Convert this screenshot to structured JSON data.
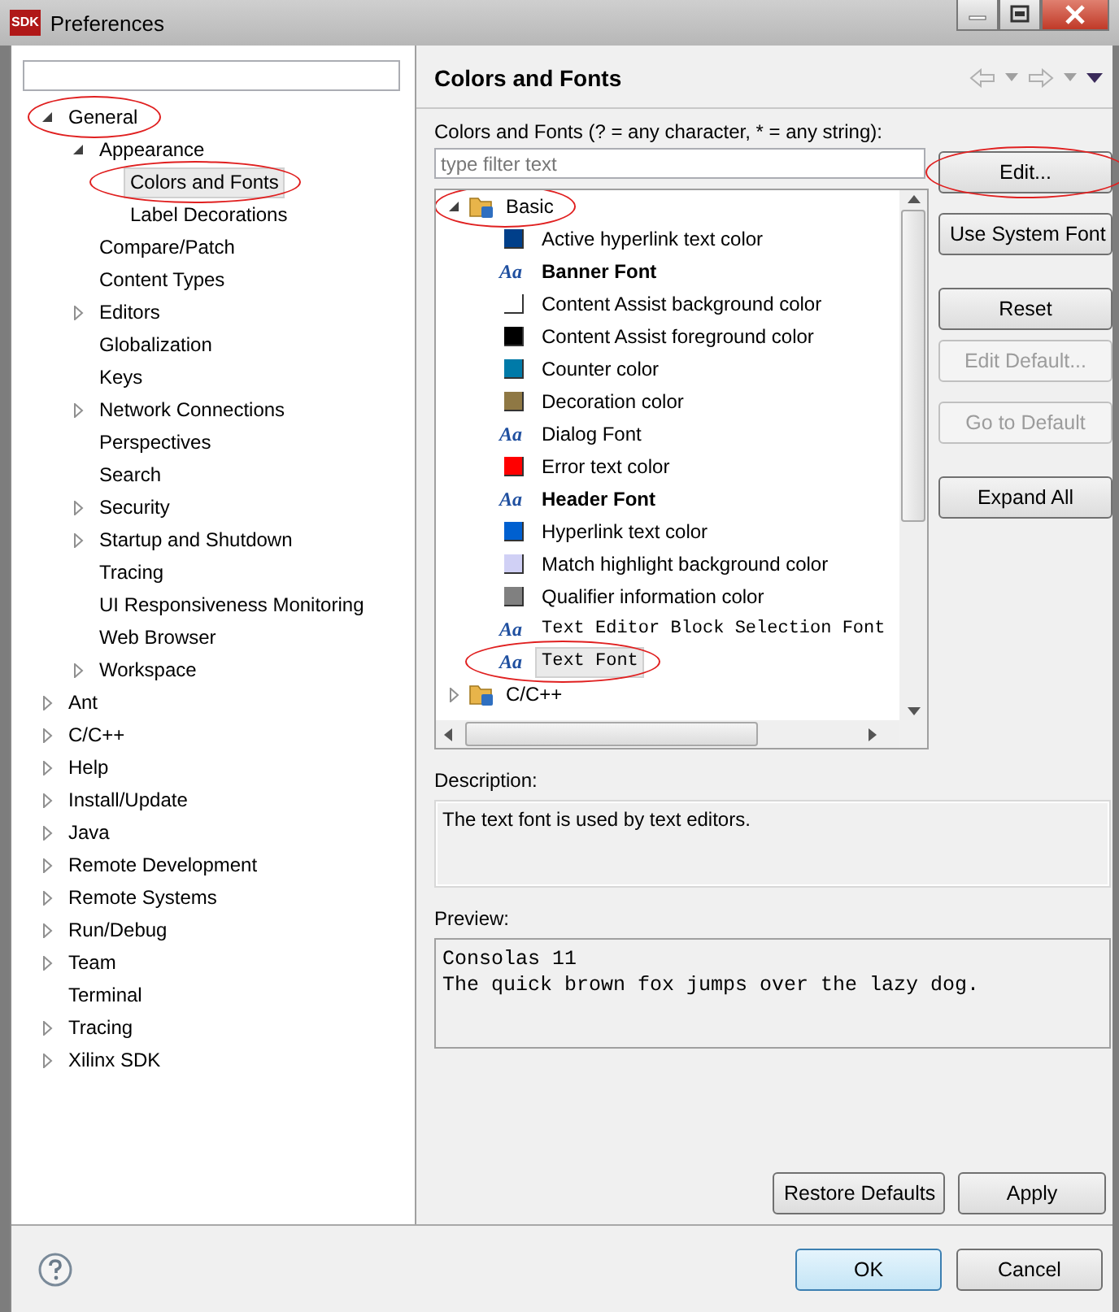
{
  "window": {
    "title": "Preferences",
    "app_icon": "SDK"
  },
  "sidebar": {
    "tree": [
      {
        "label": "General",
        "kind": "branch",
        "expanded": true,
        "selected": false,
        "circled": true,
        "children": [
          {
            "label": "Appearance",
            "kind": "branch",
            "expanded": true,
            "selected": false,
            "circled": false,
            "children": [
              {
                "label": "Colors and Fonts",
                "kind": "leaf",
                "selected": true,
                "circled": true
              },
              {
                "label": "Label Decorations",
                "kind": "leaf",
                "selected": false,
                "circled": false
              }
            ]
          },
          {
            "label": "Compare/Patch",
            "kind": "leaf",
            "selected": false,
            "circled": false
          },
          {
            "label": "Content Types",
            "kind": "leaf",
            "selected": false,
            "circled": false
          },
          {
            "label": "Editors",
            "kind": "branch",
            "expanded": false,
            "selected": false,
            "circled": false
          },
          {
            "label": "Globalization",
            "kind": "leaf",
            "selected": false,
            "circled": false
          },
          {
            "label": "Keys",
            "kind": "leaf",
            "selected": false,
            "circled": false
          },
          {
            "label": "Network Connections",
            "kind": "branch",
            "expanded": false,
            "selected": false,
            "circled": false
          },
          {
            "label": "Perspectives",
            "kind": "leaf",
            "selected": false,
            "circled": false
          },
          {
            "label": "Search",
            "kind": "leaf",
            "selected": false,
            "circled": false
          },
          {
            "label": "Security",
            "kind": "branch",
            "expanded": false,
            "selected": false,
            "circled": false
          },
          {
            "label": "Startup and Shutdown",
            "kind": "branch",
            "expanded": false,
            "selected": false,
            "circled": false
          },
          {
            "label": "Tracing",
            "kind": "leaf",
            "selected": false,
            "circled": false
          },
          {
            "label": "UI Responsiveness Monitoring",
            "kind": "leaf",
            "selected": false,
            "circled": false
          },
          {
            "label": "Web Browser",
            "kind": "leaf",
            "selected": false,
            "circled": false
          },
          {
            "label": "Workspace",
            "kind": "branch",
            "expanded": false,
            "selected": false,
            "circled": false
          }
        ]
      },
      {
        "label": "Ant",
        "kind": "branch",
        "expanded": false,
        "selected": false,
        "circled": false
      },
      {
        "label": "C/C++",
        "kind": "branch",
        "expanded": false,
        "selected": false,
        "circled": false
      },
      {
        "label": "Help",
        "kind": "branch",
        "expanded": false,
        "selected": false,
        "circled": false
      },
      {
        "label": "Install/Update",
        "kind": "branch",
        "expanded": false,
        "selected": false,
        "circled": false
      },
      {
        "label": "Java",
        "kind": "branch",
        "expanded": false,
        "selected": false,
        "circled": false
      },
      {
        "label": "Remote Development",
        "kind": "branch",
        "expanded": false,
        "selected": false,
        "circled": false
      },
      {
        "label": "Remote Systems",
        "kind": "branch",
        "expanded": false,
        "selected": false,
        "circled": false
      },
      {
        "label": "Run/Debug",
        "kind": "branch",
        "expanded": false,
        "selected": false,
        "circled": false
      },
      {
        "label": "Team",
        "kind": "branch",
        "expanded": false,
        "selected": false,
        "circled": false
      },
      {
        "label": "Terminal",
        "kind": "leaf",
        "selected": false,
        "circled": false
      },
      {
        "label": "Tracing",
        "kind": "branch",
        "expanded": false,
        "selected": false,
        "circled": false
      },
      {
        "label": "Xilinx SDK",
        "kind": "branch",
        "expanded": false,
        "selected": false,
        "circled": false
      }
    ]
  },
  "page": {
    "title": "Colors and Fonts",
    "filter_label": "Colors and Fonts (? = any character, * = any string):",
    "filter": {
      "placeholder": "type filter text"
    },
    "tree": [
      {
        "label": "Basic",
        "kind": "category",
        "expanded": true,
        "selected": false,
        "circled": true,
        "children": [
          {
            "label": "Active hyperlink text color",
            "kind": "color",
            "color": "#003f8a",
            "selected": false,
            "circled": false
          },
          {
            "label": "Banner Font",
            "kind": "font",
            "icon": "Aa",
            "bold": true,
            "monospace": false,
            "selected": false,
            "circled": false
          },
          {
            "label": "Content Assist background color",
            "kind": "color",
            "color": "#ffffff",
            "selected": false,
            "circled": false
          },
          {
            "label": "Content Assist foreground color",
            "kind": "color",
            "color": "#000000",
            "selected": false,
            "circled": false
          },
          {
            "label": "Counter color",
            "kind": "color",
            "color": "#007aa8",
            "selected": false,
            "circled": false
          },
          {
            "label": "Decoration color",
            "kind": "color",
            "color": "#8f7844",
            "selected": false,
            "circled": false
          },
          {
            "label": "Dialog Font",
            "kind": "font",
            "icon": "Aa",
            "bold": false,
            "monospace": false,
            "selected": false,
            "circled": false
          },
          {
            "label": "Error text color",
            "kind": "color",
            "color": "#ff0000",
            "selected": false,
            "circled": false
          },
          {
            "label": "Header Font",
            "kind": "font",
            "icon": "Aa",
            "bold": true,
            "monospace": false,
            "selected": false,
            "circled": false
          },
          {
            "label": "Hyperlink text color",
            "kind": "color",
            "color": "#0060d0",
            "selected": false,
            "circled": false
          },
          {
            "label": "Match highlight background color",
            "kind": "color",
            "color": "#d0d0f5",
            "selected": false,
            "circled": false
          },
          {
            "label": "Qualifier information color",
            "kind": "color",
            "color": "#808080",
            "selected": false,
            "circled": false
          },
          {
            "label": "Text Editor Block Selection Font",
            "kind": "font",
            "icon": "Aa",
            "bold": false,
            "monospace": true,
            "selected": false,
            "circled": false
          },
          {
            "label": "Text Font",
            "kind": "font",
            "icon": "Aa",
            "bold": false,
            "monospace": true,
            "selected": true,
            "circled": true
          }
        ]
      },
      {
        "label": "C/C++",
        "kind": "category",
        "expanded": false,
        "selected": false,
        "circled": false
      }
    ],
    "buttons": [
      {
        "label": "Edit...",
        "disabled": false,
        "circled": true
      },
      {
        "label": "Use System Font",
        "disabled": false,
        "circled": false
      },
      {
        "label": "Reset",
        "disabled": false,
        "circled": false
      },
      {
        "label": "Edit Default...",
        "disabled": true,
        "circled": false
      },
      {
        "label": "Go to Default",
        "disabled": true,
        "circled": false
      },
      {
        "label": "Expand All",
        "disabled": false,
        "circled": false
      }
    ],
    "description_label": "Description:",
    "description": "The text font is used by text editors.",
    "preview_label": "Preview:",
    "preview": [
      "Consolas 11",
      "The quick brown fox jumps over the lazy dog."
    ],
    "page_buttons": [
      "Restore Defaults",
      "Apply"
    ]
  },
  "footer": {
    "buttons": [
      {
        "label": "OK",
        "default": true
      },
      {
        "label": "Cancel",
        "default": false
      }
    ]
  }
}
